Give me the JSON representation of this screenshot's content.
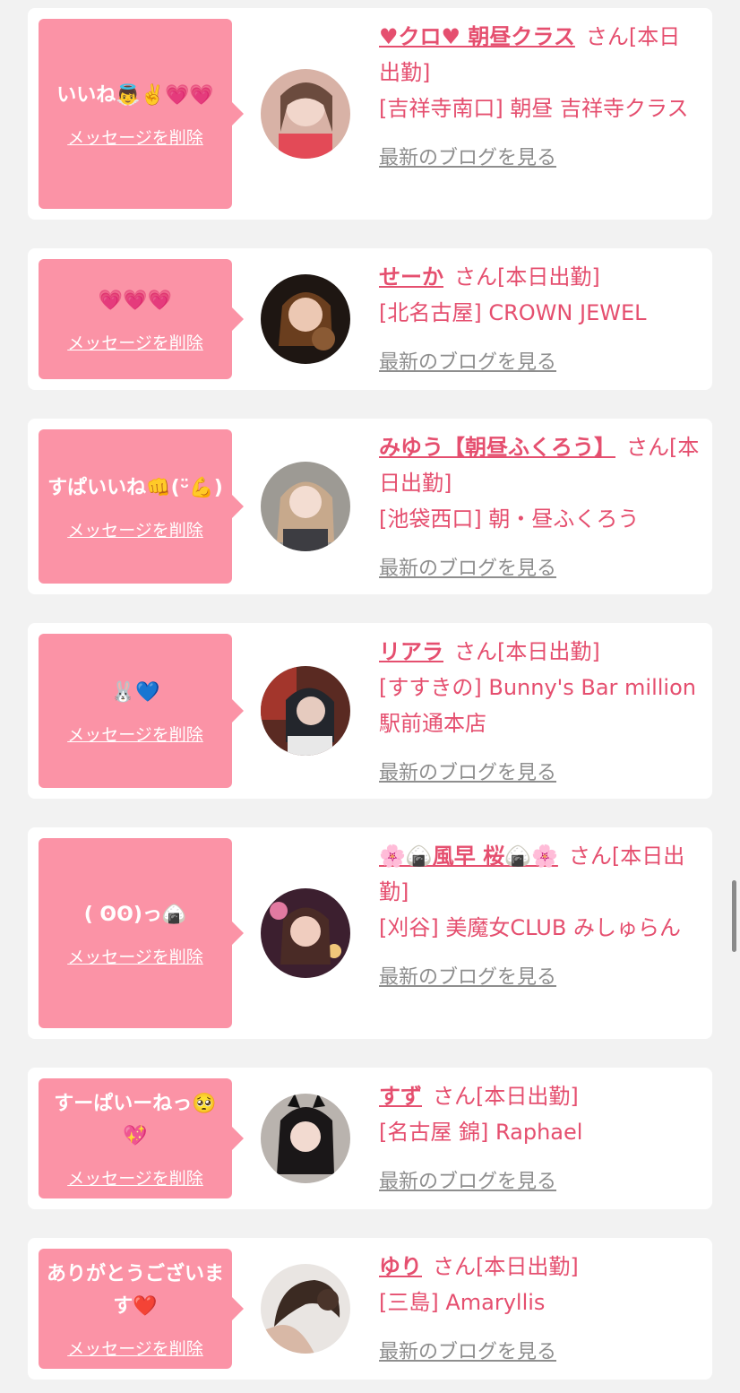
{
  "delete_label": "メッセージを削除",
  "blog_label": "最新のブログを見る",
  "entries": [
    {
      "message": "いいね👼✌️💗💗",
      "name": "♥クロ♥ 朝昼クラス",
      "suffix": "さん[本日出勤]",
      "shop": "[吉祥寺南口] 朝昼 吉祥寺クラス"
    },
    {
      "message": "💗💗💗",
      "name": "せーか",
      "suffix": "さん[本日出勤]",
      "shop": "[北名古屋] CROWN JEWEL"
    },
    {
      "message": "すぱいいね👊(ᵕ̈💪)",
      "name": "みゆう【朝昼ふくろう】",
      "suffix": "さん[本日出勤]",
      "shop": "[池袋西口] 朝・昼ふくろう"
    },
    {
      "message": "🐰💙",
      "name": "リアラ",
      "suffix": "さん[本日出勤]",
      "shop": "[すすきの] Bunny's Bar million 駅前通本店"
    },
    {
      "message": "( ʘʘ)っ🍙",
      "name": "🌸🍙風早 桜🍙🌸",
      "suffix": "さん[本日出勤]",
      "shop": "[刈谷] 美魔女CLUB みしゅらん"
    },
    {
      "message": "すーぱいーねっ🥺💖",
      "name": "すず",
      "suffix": "さん[本日出勤]",
      "shop": "[名古屋 錦] Raphael"
    },
    {
      "message": "ありがとうございます❤️",
      "name": "ゆり",
      "suffix": "さん[本日出勤]",
      "shop": "[三島] Amaryllis"
    }
  ]
}
